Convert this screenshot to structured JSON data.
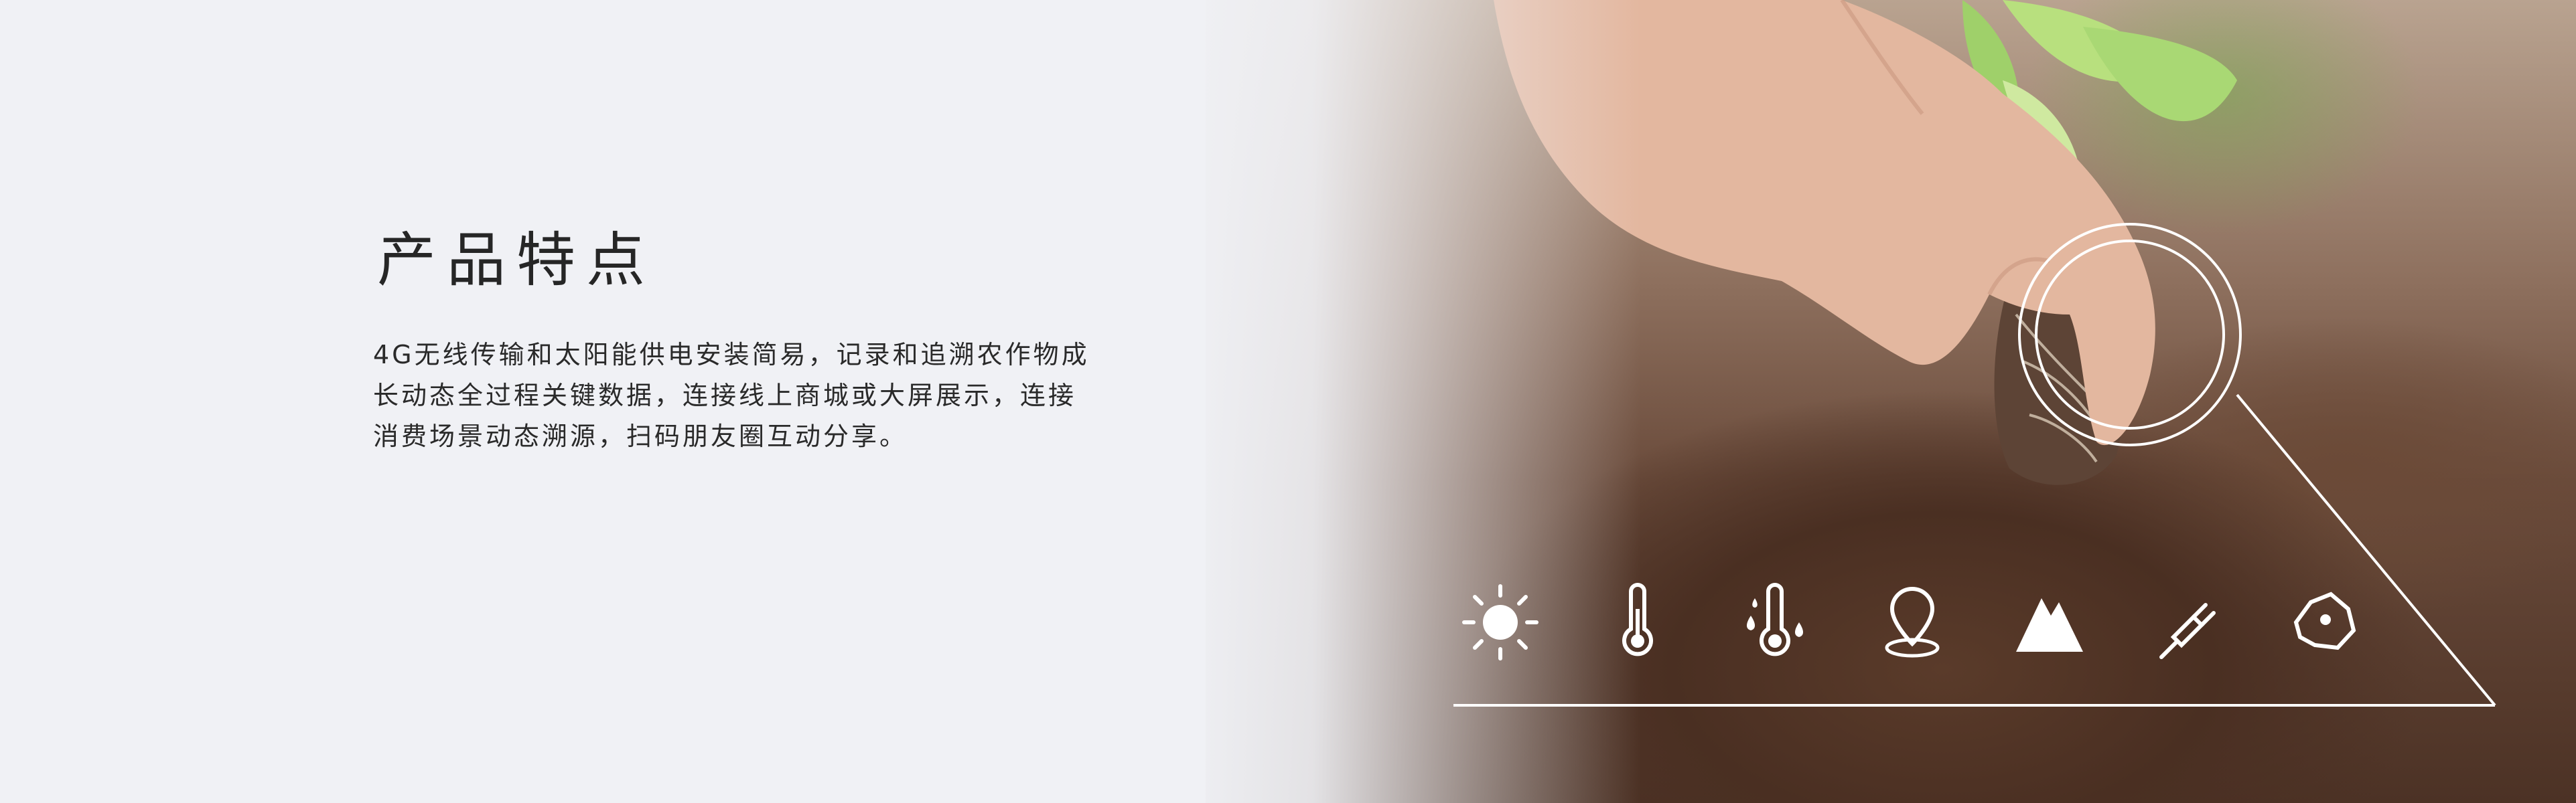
{
  "hero": {
    "title": "产品特点",
    "description_lines": [
      "4G无线传输和太阳能供电安装简易，记录和追溯农作物成",
      "长动态全过程关键数据，连接线上商城或大屏展示，连接",
      "消费场景动态溯源，扫码朋友圈互动分享。"
    ]
  },
  "feature_icons": [
    "sun-icon",
    "thermometer-icon",
    "humidity-thermometer-icon",
    "location-pin-icon",
    "mountain-icon",
    "plug-icon",
    "map-region-icon"
  ],
  "colors": {
    "background": "#f0f1f5",
    "text": "#262626",
    "overlay_line": "#ffffff"
  }
}
